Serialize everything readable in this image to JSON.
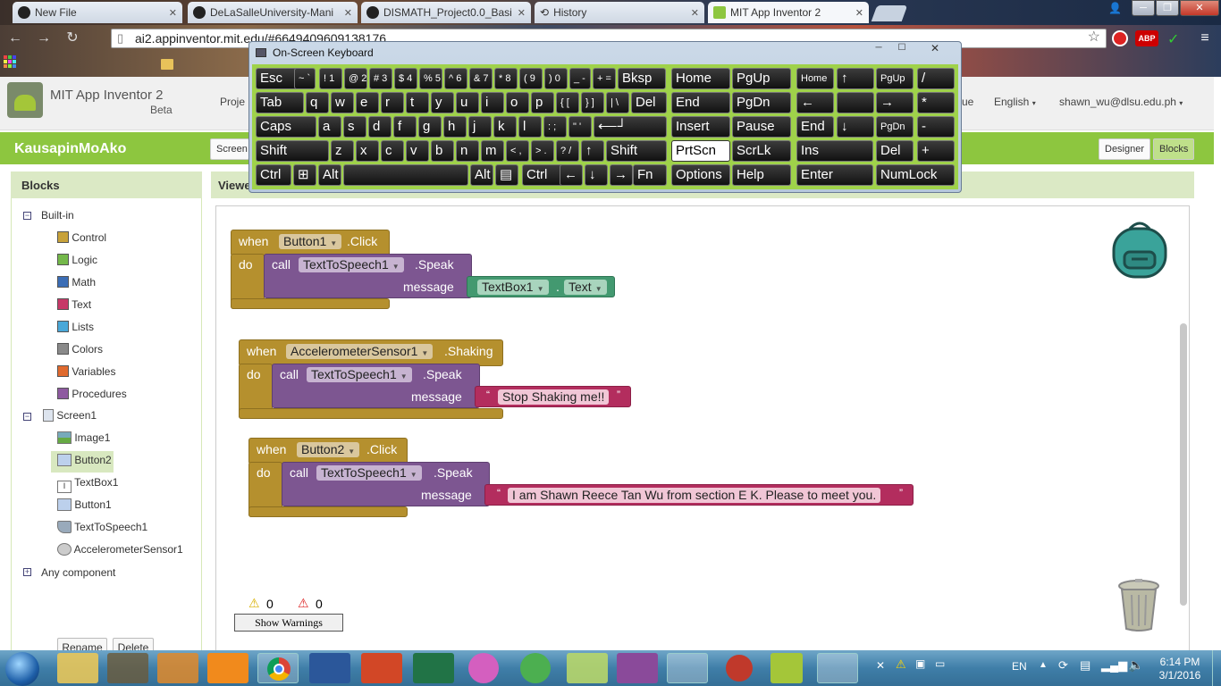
{
  "browser": {
    "tabs": [
      {
        "title": "New File"
      },
      {
        "title": "DeLaSalleUniversity-Mani"
      },
      {
        "title": "DISMATH_Project0.0_Basi"
      },
      {
        "title": "History"
      },
      {
        "title": "MIT App Inventor 2"
      }
    ],
    "url": "ai2.appinventor.mit.edu/#6649409609138176"
  },
  "app": {
    "brand": "MIT App Inventor 2",
    "beta": "Beta",
    "menu_projects": "Proje",
    "menu_ue": "ue",
    "language": "English",
    "user": "shawn_wu@dlsu.edu.ph",
    "project_name": "KausapinMoAko",
    "screen_btn": "Screen",
    "designer_btn": "Designer",
    "blocks_btn": "Blocks"
  },
  "blocks_panel": {
    "title": "Blocks",
    "builtin": "Built-in",
    "items": [
      {
        "label": "Control",
        "color": "#c8a23a"
      },
      {
        "label": "Logic",
        "color": "#74b84a"
      },
      {
        "label": "Math",
        "color": "#3b6db5"
      },
      {
        "label": "Text",
        "color": "#c73868"
      },
      {
        "label": "Lists",
        "color": "#4aa8d8"
      },
      {
        "label": "Colors",
        "color": "#8a8a8a"
      },
      {
        "label": "Variables",
        "color": "#e06a2e"
      },
      {
        "label": "Procedures",
        "color": "#8e5aa0"
      }
    ],
    "screen": "Screen1",
    "components": [
      "Image1",
      "Button2",
      "TextBox1",
      "Button1",
      "TextToSpeech1",
      "AccelerometerSensor1"
    ],
    "any_component": "Any component",
    "rename": "Rename",
    "delete": "Delete"
  },
  "viewer": {
    "title": "Viewe",
    "warnings_count": "0",
    "errors_count": "0",
    "show_warnings": "Show Warnings"
  },
  "code_blocks": [
    {
      "when": "when",
      "component": "Button1",
      "event": ".Click",
      "do": "do",
      "call": "call",
      "target": "TextToSpeech1",
      "method": ".Speak",
      "param": "message",
      "arg_component": "TextBox1",
      "arg_dot": ".",
      "arg_prop": "Text"
    },
    {
      "when": "when",
      "component": "AccelerometerSensor1",
      "event": ".Shaking",
      "do": "do",
      "call": "call",
      "target": "TextToSpeech1",
      "method": ".Speak",
      "param": "message",
      "open_quote": "“",
      "text": "Stop Shaking me!!",
      "close_quote": "”"
    },
    {
      "when": "when",
      "component": "Button2",
      "event": ".Click",
      "do": "do",
      "call": "call",
      "target": "TextToSpeech1",
      "method": ".Speak",
      "param": "message",
      "open_quote": "“",
      "text": "I am Shawn Reece Tan Wu from section E K. Please to meet you.",
      "close_quote": "”"
    }
  ],
  "osk": {
    "title": "On-Screen Keyboard",
    "rows": [
      [
        "Esc",
        "~ `",
        "! 1",
        "@ 2",
        "# 3",
        "$ 4",
        "% 5",
        "^ 6",
        "& 7",
        "* 8",
        "( 9",
        ") 0",
        "_ -",
        "+ =",
        "Bksp",
        "Home",
        "PgUp",
        "Home",
        "↑",
        "PgUp",
        "/"
      ],
      [
        "Tab",
        "q",
        "w",
        "e",
        "r",
        "t",
        "y",
        "u",
        "i",
        "o",
        "p",
        "{ [",
        "} ]",
        "| \\",
        "Del",
        "End",
        "PgDn",
        "←",
        "",
        "→",
        "*"
      ],
      [
        "Caps",
        "a",
        "s",
        "d",
        "f",
        "g",
        "h",
        "j",
        "k",
        "l",
        ": ;",
        "\" '",
        "⟵┘",
        "Insert",
        "Pause",
        "End",
        "↓",
        "PgDn",
        "-"
      ],
      [
        "Shift",
        "z",
        "x",
        "c",
        "v",
        "b",
        "n",
        "m",
        "< ,",
        "> .",
        "? /",
        "↑",
        "Shift",
        "PrtScn",
        "ScrLk",
        "Ins",
        "Del",
        "+"
      ],
      [
        "Ctrl",
        "⊞",
        "Alt",
        "",
        "Alt",
        "▤",
        "Ctrl",
        "←",
        "↓",
        "→",
        "Fn",
        "Options",
        "Help",
        "Enter",
        "NumLock"
      ]
    ]
  },
  "taskbar": {
    "lang": "EN",
    "time": "6:14 PM",
    "date": "3/1/2016"
  }
}
